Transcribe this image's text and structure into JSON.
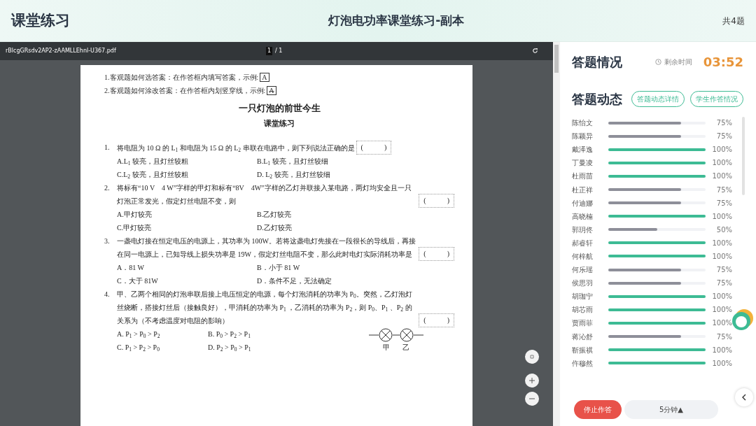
{
  "header": {
    "app_title": "课堂练习",
    "exercise_title": "灯泡电功率课堂练习-副本",
    "question_count": "共4题"
  },
  "viewer": {
    "filename": "rBlcgGRsdv2AP2-zAAMLLEhnl-U367.pdf",
    "page_current": "1",
    "page_total": "/ 1",
    "instructions": [
      {
        "text": "1.客观题如何选答案：在作答框内填写答案，示例:",
        "sample": "A",
        "struck": false
      },
      {
        "text": "2.客观题如何涂改答案：在作答框内划竖穿线，示例:",
        "sample": "A",
        "struck": true
      }
    ],
    "doc_title": "一只灯泡的前世今生",
    "doc_subtitle": "课堂练习",
    "questions": [
      {
        "number": "1.",
        "text": "将电阻为 10 Ω 的 L$_{1}$ 和电阻为 15 Ω 的 L$_{2}$ 串联在电路中，则下列说法正确的是",
        "blank": "(            )",
        "options": [
          "A.L$_{1}$ 较亮，且灯丝较粗",
          "B.L$_{1}$ 较亮，且灯丝较细",
          "C.L$_{2}$ 较亮，且灯丝较粗",
          "D. L$_{2}$ 较亮，且灯丝较细"
        ]
      },
      {
        "number": "2.",
        "text": "将标有“10 V　4 W”字样的甲灯和标有“8V　4W”字样的乙灯并联接入某电路，两灯均安全且一只灯泡正常发光，假定灯丝电阻不变，则",
        "blank": "(            )",
        "options": [
          "A.甲灯较亮",
          "B.乙灯较亮",
          "C.甲灯较亮",
          "D.乙灯较亮"
        ]
      },
      {
        "number": "3.",
        "text": "一盏电灯接在恒定电压的电源上，其功率为 100W。若将这盏电灯先接在一段很长的导线后，再接在同一电源上，已知导线上损失功率是 19W，假定灯丝电阻不变，那么此时电灯实际消耗功率是",
        "blank": "(            )",
        "options": [
          "A．81 W",
          "B．小于 81 W",
          "C．大于 81W",
          "D．条件不足，无法确定"
        ]
      },
      {
        "number": "4.",
        "text": "甲、乙两个相同的灯泡串联后接上电压恒定的电源，每个灯泡消耗的功率为 P$_{0}$。突然，乙灯泡灯丝烧断，搭接灯丝后（接触良好），甲消耗的功率为 P$_{1}$ ，乙消耗的功率为 P$_{2}$，则 P$_{0}$、P$_{1}$ 、P$_{2}$ 的关系为（不考虑温度对电阻的影响）",
        "blank": "(            )",
        "options": [
          "A. P$_{1}$ > P$_{0}$ > P$_{2}$",
          "B. P$_{0}$ > P$_{2}$ > P$_{1}$",
          "C. P$_{1}$ > P$_{2}$ > P$_{0}$",
          "D. P$_{2}$ > P$_{0}$ > P$_{1}$"
        ],
        "circuit_labels": [
          "甲",
          "乙"
        ]
      }
    ]
  },
  "panel": {
    "status_title": "答题情况",
    "time_label": "剩余时间",
    "time_left": "03:52",
    "activity_title": "答题动态",
    "buttons": [
      "答题动态详情",
      "学生作答情况"
    ],
    "students": [
      {
        "name": "陈怡文",
        "level": 0.75,
        "percent": "75%"
      },
      {
        "name": "陈颖异",
        "level": 0.75,
        "percent": "75%"
      },
      {
        "name": "戴泽逸",
        "level": 1,
        "percent": "100%"
      },
      {
        "name": "丁曼凌",
        "level": 1,
        "percent": "100%"
      },
      {
        "name": "杜雨苗",
        "level": 1,
        "percent": "100%"
      },
      {
        "name": "杜正祥",
        "level": 0.75,
        "percent": "75%"
      },
      {
        "name": "付迪娜",
        "level": 0.75,
        "percent": "75%"
      },
      {
        "name": "高晓楠",
        "level": 1,
        "percent": "100%"
      },
      {
        "name": "郭玥佟",
        "level": 0.5,
        "percent": "50%"
      },
      {
        "name": "郝睿轩",
        "level": 1,
        "percent": "100%"
      },
      {
        "name": "何梓航",
        "level": 1,
        "percent": "100%"
      },
      {
        "name": "何乐瑶",
        "level": 0.75,
        "percent": "75%"
      },
      {
        "name": "侯思羽",
        "level": 0.75,
        "percent": "75%"
      },
      {
        "name": "胡珈宁",
        "level": 1,
        "percent": "100%"
      },
      {
        "name": "胡芯雨",
        "level": 1,
        "percent": "100%"
      },
      {
        "name": "贾雨菲",
        "level": 1,
        "percent": "100%"
      },
      {
        "name": "蒋沁舒",
        "level": 0.75,
        "percent": "75%"
      },
      {
        "name": "靳振祺",
        "level": 1,
        "percent": "100%"
      },
      {
        "name": "仵穆然",
        "level": 1,
        "percent": "100%"
      }
    ],
    "stop_button": "停止作答",
    "extend_button": "5分钟▲"
  }
}
